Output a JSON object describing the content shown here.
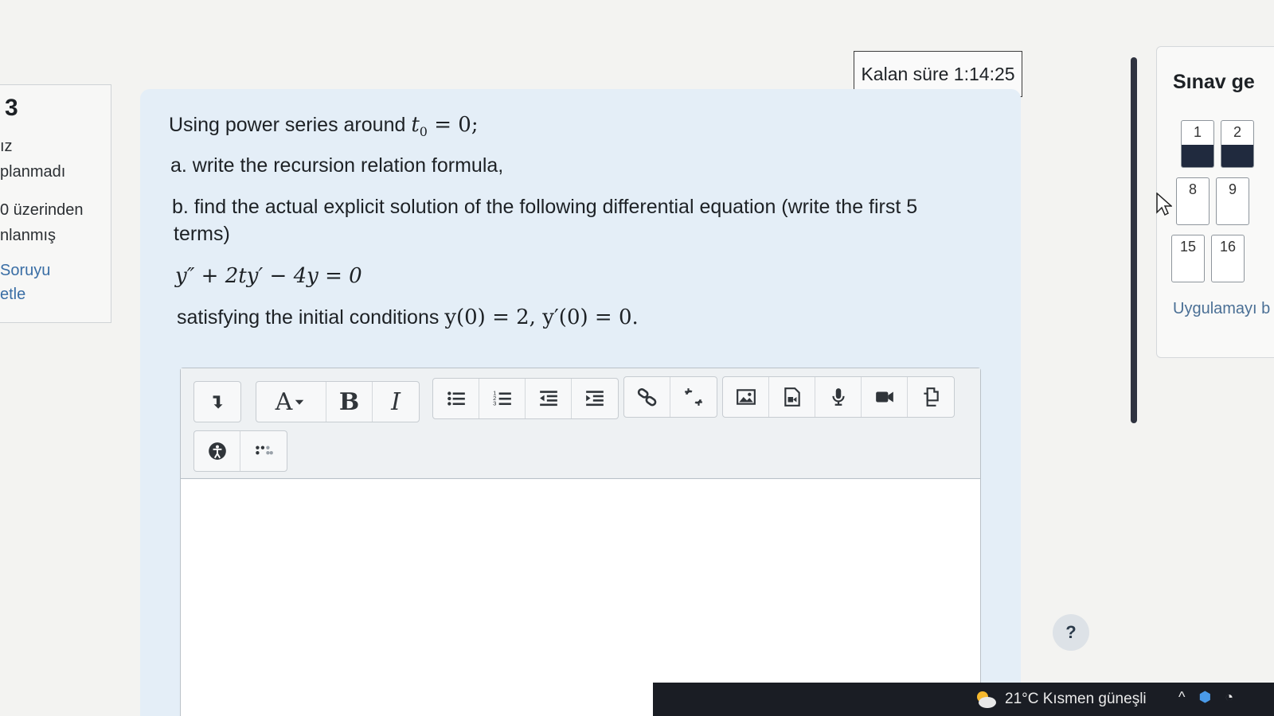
{
  "question_info": {
    "number": "3",
    "lines": [
      "ız",
      "planmadı",
      "0 üzerinden",
      "nlanmış",
      "Soruyu",
      "etle"
    ]
  },
  "timer": {
    "text": "Kalan süre 1:14:25"
  },
  "question": {
    "intro_text": "Using power series around",
    "intro_math": "t",
    "intro_sub": "0",
    "intro_rest": " = 0;",
    "part_a": "a. write the recursion relation formula,",
    "part_b_line1": "b. find the actual explicit solution of the following differential equation (write the first 5",
    "part_b_line2": "terms)",
    "equation": "y″ + 2ty′ − 4y = 0",
    "condition_text": "satisfying the initial conditions",
    "condition_math": "y(0) = 2, y′(0) = 0."
  },
  "editor": {
    "toolbar_icons": [
      "expand-toolbar-icon",
      "font-style-icon",
      "bold-icon",
      "italic-icon",
      "unordered-list-icon",
      "ordered-list-icon",
      "outdent-icon",
      "indent-icon",
      "link-icon",
      "unlink-icon",
      "image-icon",
      "media-icon",
      "record-audio-icon",
      "record-video-icon",
      "manage-files-icon",
      "accessibility-checker-icon",
      "screenreader-helper-icon"
    ],
    "font_label": "A",
    "bold_label": "B",
    "italic_label": "I",
    "content": ""
  },
  "help": {
    "label": "?"
  },
  "quiz_nav": {
    "title": "Sınav ge",
    "cells": [
      {
        "label": "1",
        "answered": true
      },
      {
        "label": "2",
        "answered": true
      },
      {
        "label": "8",
        "answered": false
      },
      {
        "label": "9",
        "answered": false
      },
      {
        "label": "15",
        "answered": false
      },
      {
        "label": "16",
        "answered": false
      }
    ],
    "footer": "Uygulamayı b"
  },
  "taskbar": {
    "weather": "21°C  Kısmen güneşli",
    "colors": {
      "bar": "#1a1d24"
    }
  },
  "colors": {
    "question_bg": "#e4eef7",
    "nav_fill": "#202a3e",
    "link": "#4a6f95"
  }
}
